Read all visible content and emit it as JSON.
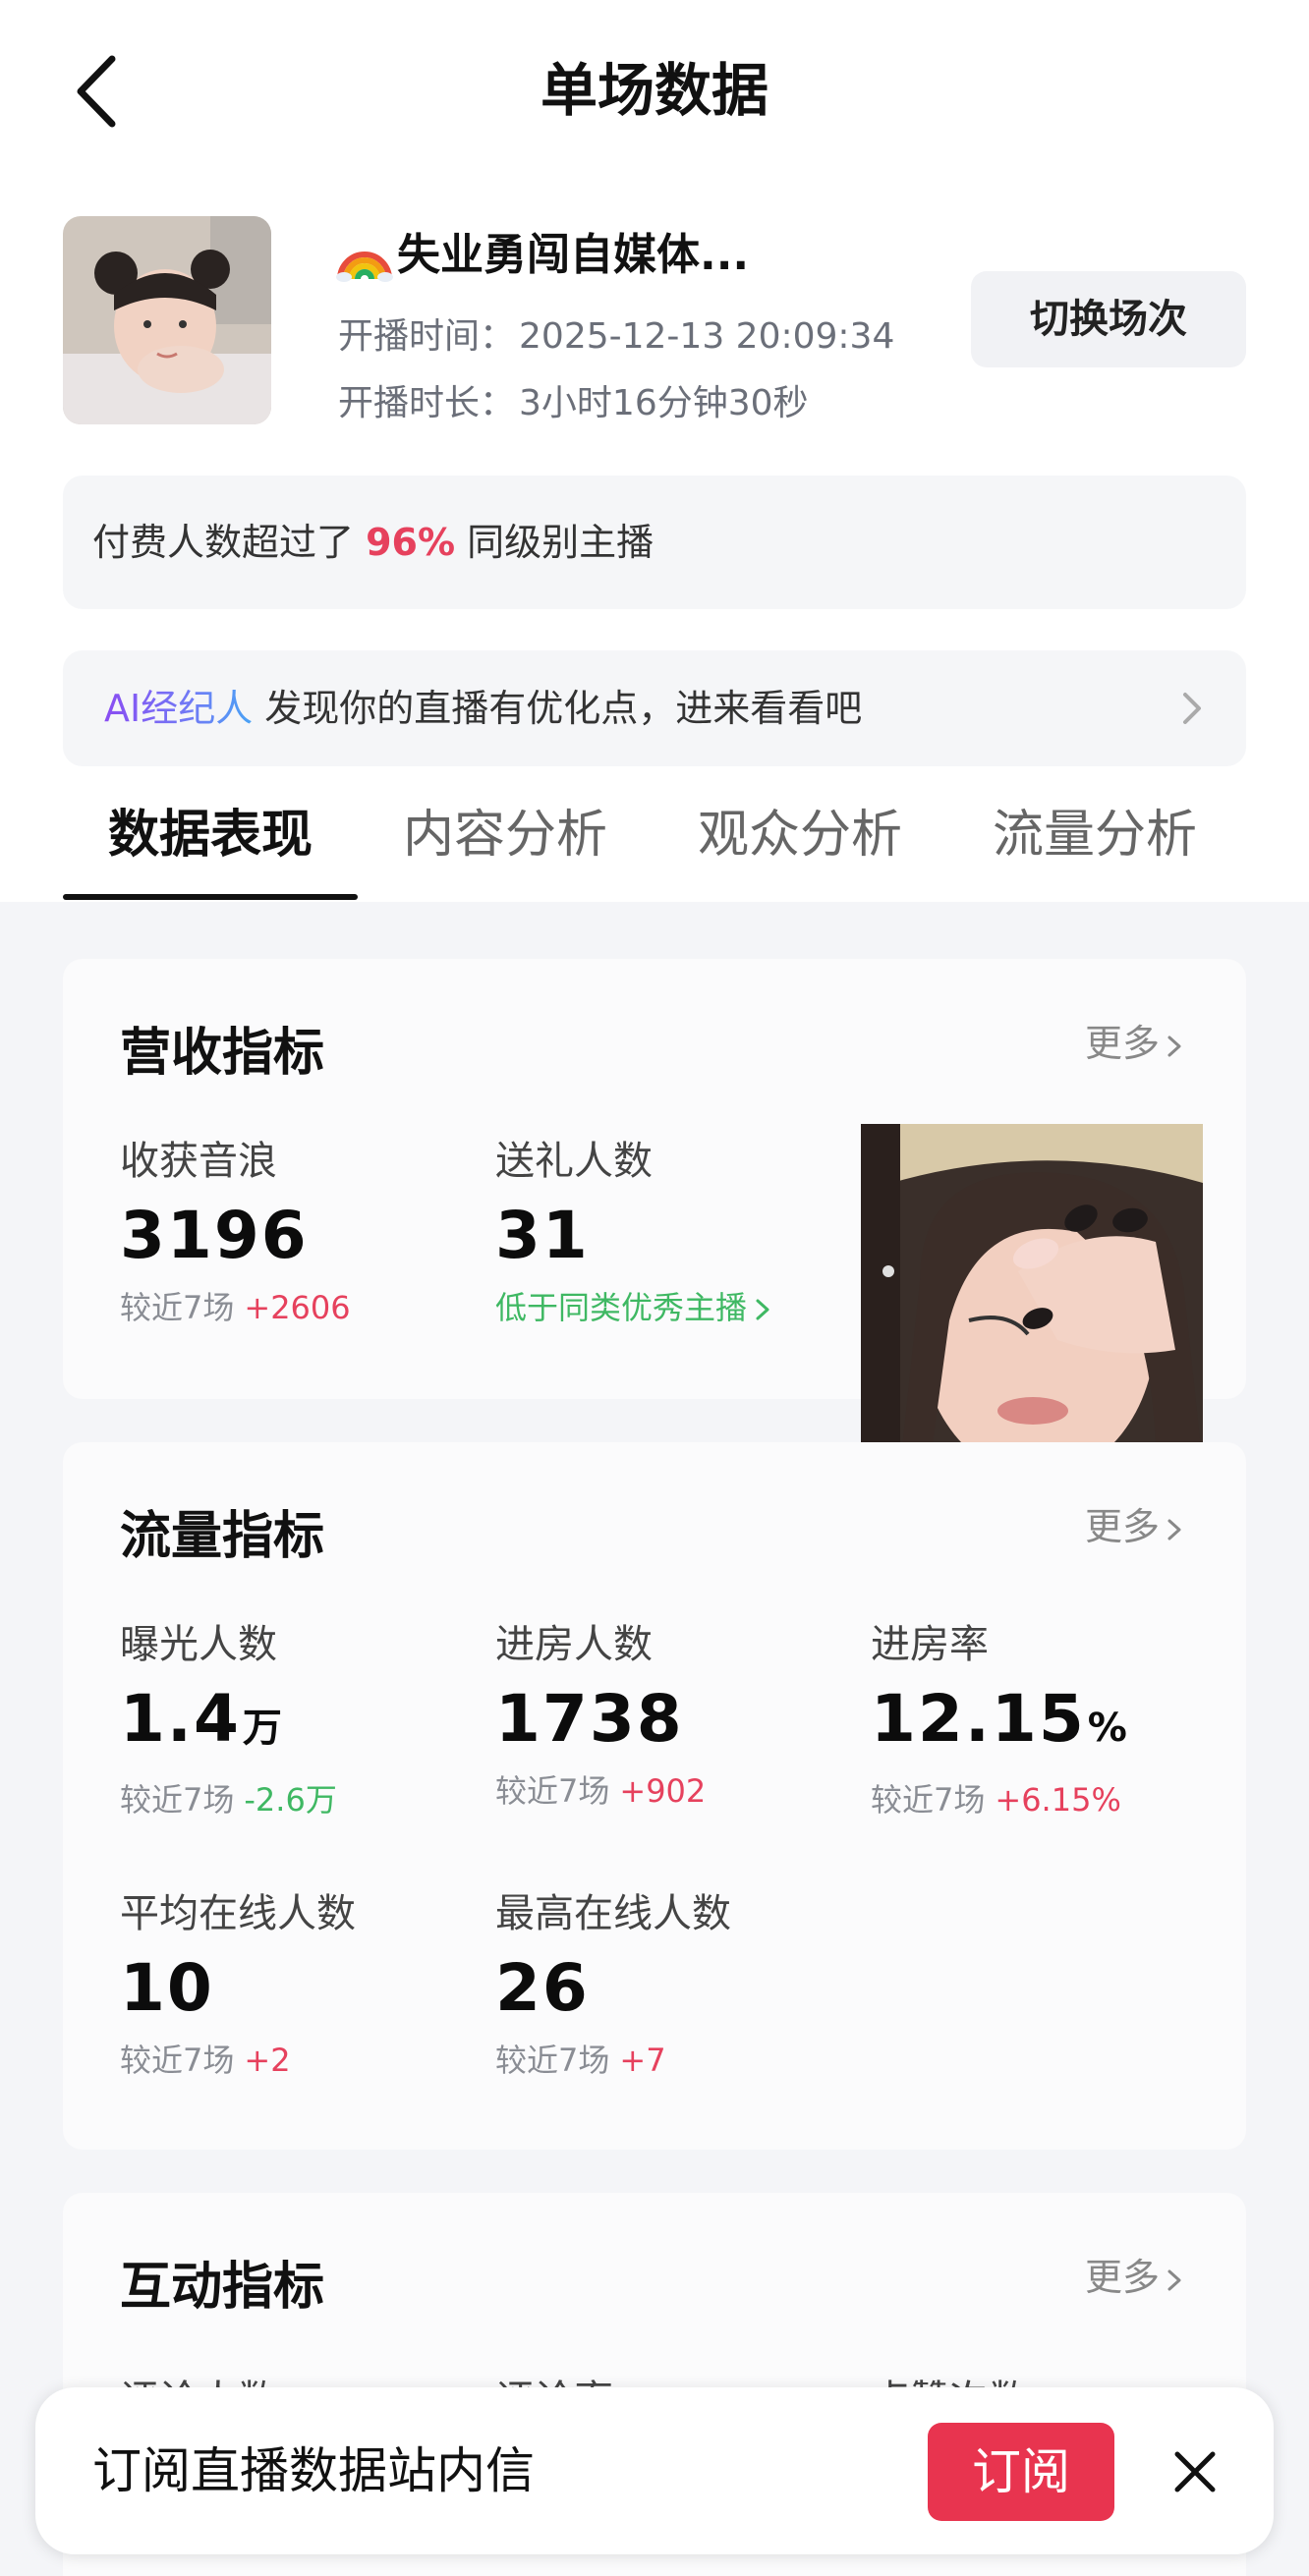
{
  "header": {
    "title": "单场数据"
  },
  "streamer": {
    "name": "失业勇闯自媒体...",
    "start_label": "开播时间：",
    "start_time": "2025-12-13 20:09:34",
    "duration_label": "开播时长：",
    "duration": "3小时16分钟30秒",
    "switch_label": "切换场次"
  },
  "notice": {
    "prefix": "付费人数超过了 ",
    "percent": "96%",
    "suffix": " 同级别主播"
  },
  "ai_banner": {
    "ai_label": "AI经纪人",
    "text": " 发现你的直播有优化点，进来看看吧"
  },
  "tabs": [
    {
      "label": "数据表现"
    },
    {
      "label": "内容分析"
    },
    {
      "label": "观众分析"
    },
    {
      "label": "流量分析"
    }
  ],
  "revenue": {
    "title": "营收指标",
    "more": "更多",
    "metrics": [
      {
        "label": "收获音浪",
        "value": "3196",
        "cmp_label": "较近7场",
        "delta": "+2606"
      },
      {
        "label": "送礼人数",
        "value": "31",
        "note": "低于同类优秀主播"
      }
    ]
  },
  "traffic": {
    "title": "流量指标",
    "more": "更多",
    "metrics": [
      {
        "label": "曝光人数",
        "value": "1.4",
        "unit": "万",
        "cmp_label": "较近7场",
        "delta": "-2.6万"
      },
      {
        "label": "进房人数",
        "value": "1738",
        "cmp_label": "较近7场",
        "delta": "+902"
      },
      {
        "label": "进房率",
        "value": "12.15",
        "unit": "%",
        "cmp_label": "较近7场",
        "delta": "+6.15%"
      },
      {
        "label": "平均在线人数",
        "value": "10",
        "cmp_label": "较近7场",
        "delta": "+2"
      },
      {
        "label": "最高在线人数",
        "value": "26",
        "cmp_label": "较近7场",
        "delta": "+7"
      }
    ]
  },
  "interaction": {
    "title": "互动指标",
    "more": "更多",
    "peek_labels": [
      "评论人数",
      "评论率",
      "点赞次数"
    ]
  },
  "subscribe": {
    "text": "订阅直播数据站内信",
    "button": "订阅"
  },
  "colors": {
    "accent_red": "#e6415d",
    "green": "#3fb863",
    "button_red": "#e8344f"
  }
}
